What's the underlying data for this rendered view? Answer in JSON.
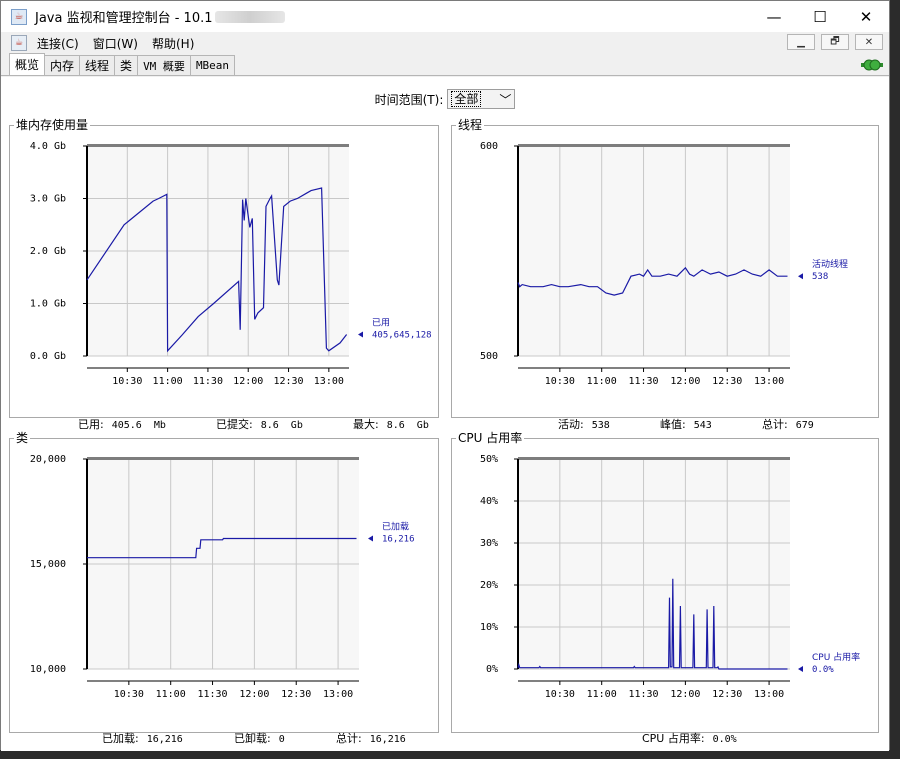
{
  "window": {
    "title": "Java 监视和管理控制台 - 10.1",
    "icon": "java-cup-icon",
    "controls": [
      "—",
      "☐",
      "✕"
    ]
  },
  "menu": {
    "items": [
      "连接(C)",
      "窗口(W)",
      "帮助(H)"
    ],
    "mdi_controls": [
      "▁",
      "🗗",
      "✕"
    ]
  },
  "tabs": [
    "概览",
    "内存",
    "线程",
    "类",
    "VM 概要",
    "MBean"
  ],
  "active_tab": 0,
  "time_range": {
    "label": "时间范围(T):",
    "value": "全部"
  },
  "charts": {
    "heap": {
      "title": "堆内存使用量",
      "y_ticks": [
        "4.0 Gb",
        "3.0 Gb",
        "2.0 Gb",
        "1.0 Gb",
        "0.0 Gb"
      ],
      "x_ticks": [
        "10:30",
        "11:00",
        "11:30",
        "12:00",
        "12:30",
        "13:00"
      ],
      "legend_name": "已用",
      "legend_value": "405,645,128",
      "stats": [
        {
          "label": "已用:",
          "value": "405.6  Mb"
        },
        {
          "label": "已提交:",
          "value": "8.6  Gb"
        },
        {
          "label": "最大:",
          "value": "8.6  Gb"
        }
      ]
    },
    "threads": {
      "title": "线程",
      "y_ticks": [
        "600",
        "500"
      ],
      "x_ticks": [
        "10:30",
        "11:00",
        "11:30",
        "12:00",
        "12:30",
        "13:00"
      ],
      "legend_name": "活动线程",
      "legend_value": "538",
      "stats": [
        {
          "label": "活动:",
          "value": "538"
        },
        {
          "label": "峰值:",
          "value": "543"
        },
        {
          "label": "总计:",
          "value": "679"
        }
      ]
    },
    "classes": {
      "title": "类",
      "y_ticks": [
        "20,000",
        "15,000",
        "10,000"
      ],
      "x_ticks": [
        "10:30",
        "11:00",
        "11:30",
        "12:00",
        "12:30",
        "13:00"
      ],
      "legend_name": "已加载",
      "legend_value": "16,216",
      "stats": [
        {
          "label": "已加载:",
          "value": "16,216"
        },
        {
          "label": "已卸载:",
          "value": "0"
        },
        {
          "label": "总计:",
          "value": "16,216"
        }
      ]
    },
    "cpu": {
      "title": "CPU 占用率",
      "y_ticks": [
        "50%",
        "40%",
        "30%",
        "20%",
        "10%",
        "0%"
      ],
      "x_ticks": [
        "10:30",
        "11:00",
        "11:30",
        "12:00",
        "12:30",
        "13:00"
      ],
      "legend_name": "CPU 占用率",
      "legend_value": "0.0%",
      "stats": [
        {
          "label": "CPU 占用率:",
          "value": "0.0%"
        }
      ]
    }
  },
  "colors": {
    "series": "#1a1aa6",
    "grid": "#c8c8c8",
    "plot_bg": "#f7f7f7",
    "frame": "#7d7d7d"
  },
  "chart_data": [
    {
      "type": "line",
      "title": "堆内存使用量",
      "ylabel": "Gb",
      "ylim": [
        0,
        4
      ],
      "xlim": [
        10.0,
        13.25
      ],
      "x_ticks": [
        10.5,
        11.0,
        11.5,
        12.0,
        12.5,
        13.0
      ],
      "series": [
        {
          "name": "已用",
          "x": [
            10.0,
            10.46,
            10.82,
            10.89,
            10.99,
            11.0,
            11.18,
            11.38,
            11.57,
            11.88,
            11.9,
            11.93,
            11.95,
            11.97,
            12.02,
            12.05,
            12.08,
            12.12,
            12.19,
            12.22,
            12.27,
            12.29,
            12.36,
            12.38,
            12.44,
            12.52,
            12.61,
            12.72,
            12.78,
            12.91,
            12.97,
            13.0,
            13.14,
            13.22
          ],
          "values": [
            1.45,
            2.5,
            2.95,
            3.0,
            3.08,
            0.1,
            0.4,
            0.75,
            1.0,
            1.42,
            0.5,
            2.98,
            2.58,
            3.0,
            2.45,
            2.62,
            0.7,
            0.82,
            0.92,
            2.85,
            3.0,
            3.05,
            1.45,
            1.35,
            2.85,
            2.95,
            3.0,
            3.1,
            3.15,
            3.2,
            0.15,
            0.1,
            0.25,
            0.41
          ]
        }
      ]
    },
    {
      "type": "line",
      "title": "线程",
      "ylim": [
        500,
        600
      ],
      "xlim": [
        10.0,
        13.25
      ],
      "x_ticks": [
        10.5,
        11.0,
        11.5,
        12.0,
        12.5,
        13.0
      ],
      "series": [
        {
          "name": "活动线程",
          "x": [
            10.0,
            10.02,
            10.05,
            10.15,
            10.3,
            10.4,
            10.5,
            10.6,
            10.75,
            10.85,
            10.95,
            11.05,
            11.15,
            11.25,
            11.35,
            11.45,
            11.5,
            11.55,
            11.6,
            11.7,
            11.8,
            11.9,
            12.0,
            12.05,
            12.1,
            12.2,
            12.3,
            12.4,
            12.5,
            12.6,
            12.7,
            12.8,
            12.9,
            13.0,
            13.1,
            13.22
          ],
          "values": [
            535,
            533,
            534,
            533,
            533,
            534,
            533,
            533,
            534,
            533,
            533,
            530,
            529,
            530,
            538,
            539,
            538,
            541,
            538,
            538,
            539,
            538,
            542,
            539,
            538,
            541,
            539,
            540,
            538,
            539,
            541,
            539,
            538,
            541,
            538,
            538
          ]
        }
      ]
    },
    {
      "type": "line",
      "title": "类",
      "ylim": [
        10000,
        20000
      ],
      "xlim": [
        10.0,
        13.25
      ],
      "x_ticks": [
        10.5,
        11.0,
        11.5,
        12.0,
        12.5,
        13.0
      ],
      "series": [
        {
          "name": "已加载",
          "x": [
            10.0,
            11.3,
            11.31,
            11.35,
            11.36,
            11.62,
            11.63,
            13.22
          ],
          "values": [
            15300,
            15300,
            15750,
            15750,
            16150,
            16150,
            16216,
            16216
          ]
        }
      ]
    },
    {
      "type": "line",
      "title": "CPU 占用率",
      "ylabel": "%",
      "ylim": [
        0,
        50
      ],
      "xlim": [
        10.0,
        13.25
      ],
      "x_ticks": [
        10.5,
        11.0,
        11.5,
        12.0,
        12.5,
        13.0
      ],
      "series": [
        {
          "name": "CPU 占用率",
          "x": [
            10.0,
            10.01,
            10.02,
            10.25,
            10.26,
            10.27,
            11.38,
            11.39,
            11.4,
            11.8,
            11.81,
            11.82,
            11.84,
            11.85,
            11.86,
            11.93,
            11.94,
            11.95,
            12.09,
            12.1,
            12.11,
            12.25,
            12.26,
            12.27,
            12.33,
            12.34,
            12.35,
            12.38,
            12.39,
            12.4,
            13.22
          ],
          "values": [
            0.3,
            1.0,
            0.3,
            0.3,
            0.6,
            0.3,
            0.3,
            0.6,
            0.3,
            0.3,
            17.0,
            0.5,
            0.5,
            21.5,
            0.3,
            0.3,
            15.0,
            0.3,
            0.3,
            13.0,
            0.3,
            0.3,
            14.2,
            0.3,
            0.3,
            15.0,
            0.3,
            0.3,
            0.5,
            0.0,
            0.0
          ]
        }
      ]
    }
  ]
}
